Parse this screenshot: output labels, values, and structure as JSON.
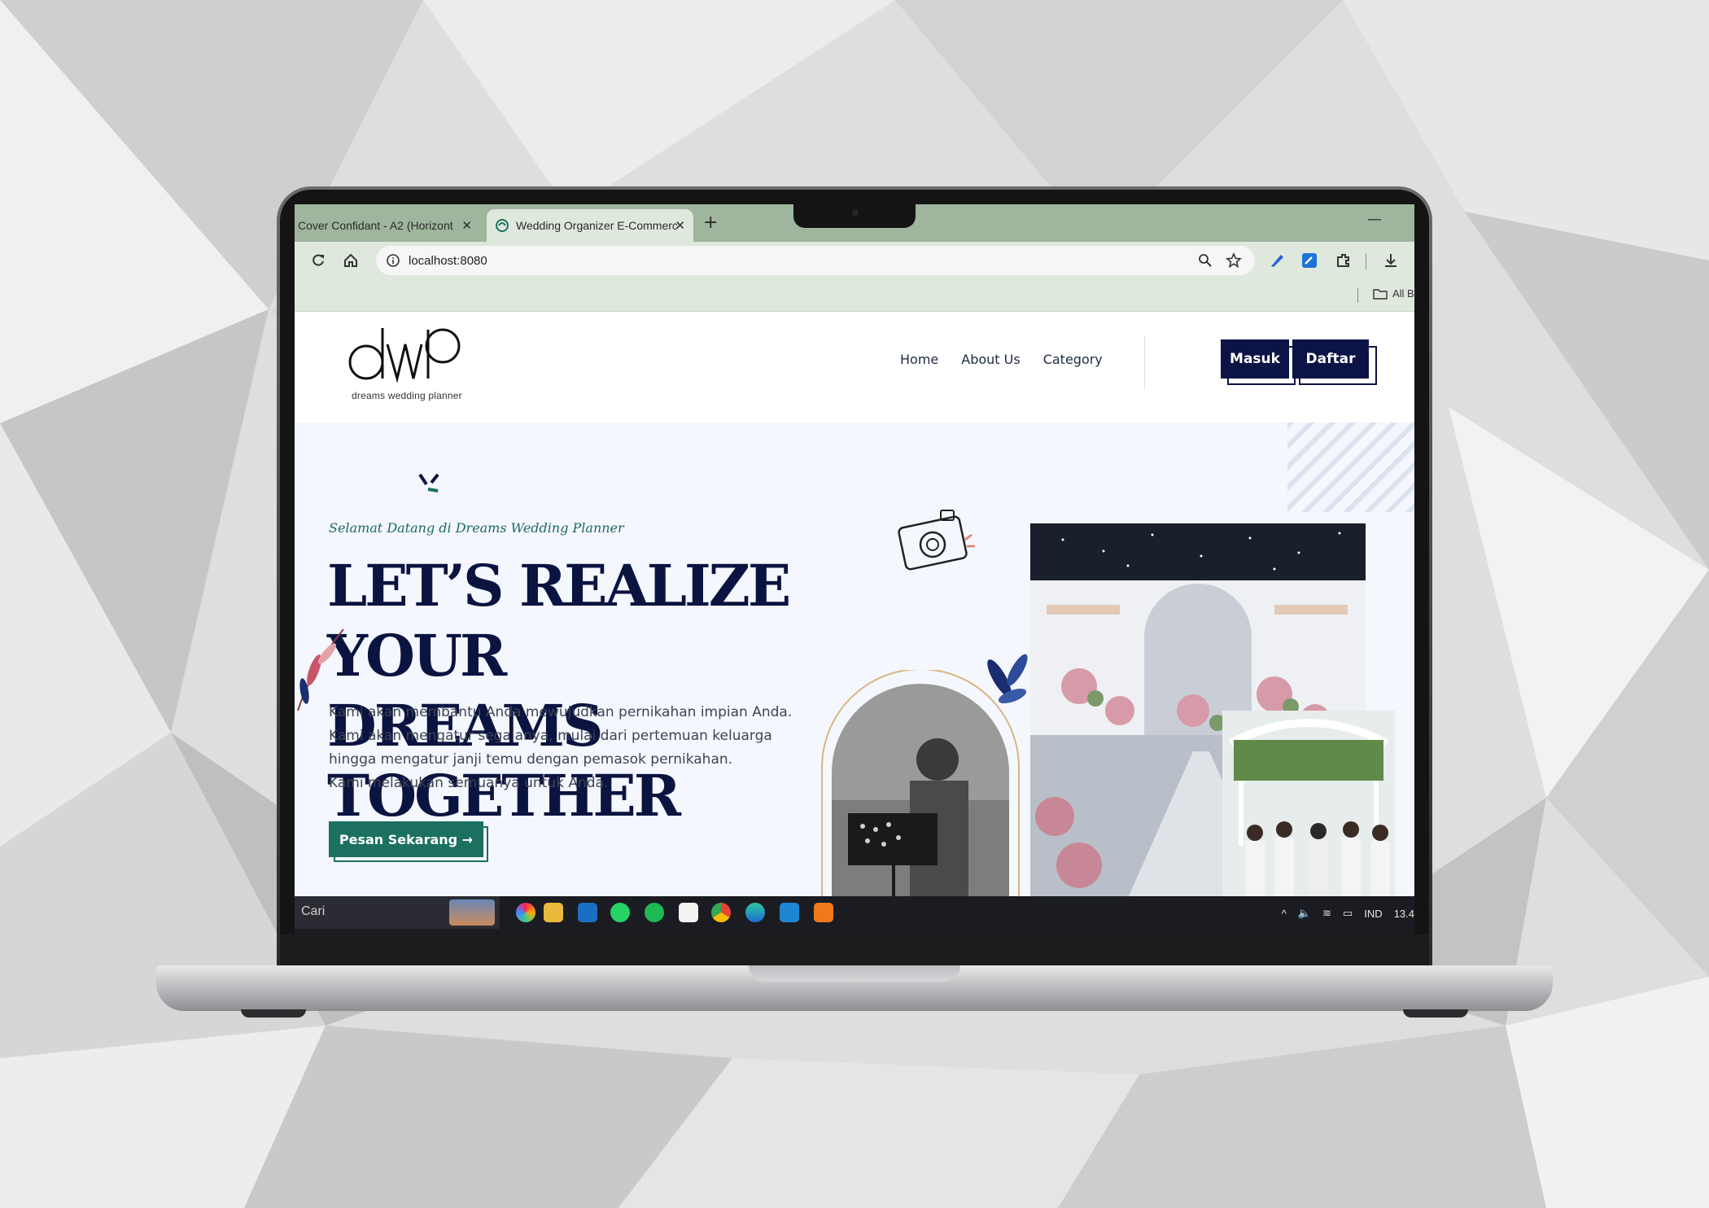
{
  "colors": {
    "nav_button": "#0c1446",
    "cta": "#1c7060",
    "headline": "#0b1440",
    "tagline": "#1e6a5a",
    "chrome": "#9fb59e"
  },
  "browser": {
    "tabs": [
      {
        "title": "Cover Confidant - A2 (Horizont",
        "active": false,
        "icon": "close-icon"
      },
      {
        "title": "Wedding Organizer E-Commerc",
        "active": true,
        "icon": "site-favicon"
      }
    ],
    "new_tab": "+",
    "minimize": "—",
    "url": "localhost:8080",
    "bookmarks_label": "All B"
  },
  "site": {
    "logo_text": "dreams wedding planner",
    "nav": [
      "Home",
      "About Us",
      "Category"
    ],
    "login_label": "Masuk",
    "register_label": "Daftar",
    "tagline": "Selamat Datang di Dreams Wedding Planner",
    "headline_line1": "LET’S REALIZE YOUR",
    "headline_line2": "DREAMS TOGETHER",
    "body_lines": [
      "Kami akan membantu Anda mewujudkan pernikahan impian Anda.",
      "Kami akan mengatur segalanya, mulai dari pertemuan keluarga",
      "hingga mengatur janji temu dengan pemasok pernikahan.",
      "Kami melakukan semuanya untuk Anda."
    ],
    "cta_label": "Pesan Sekarang →"
  },
  "taskbar": {
    "search_placeholder": "Cari",
    "language": "IND",
    "clock": "13.4"
  }
}
